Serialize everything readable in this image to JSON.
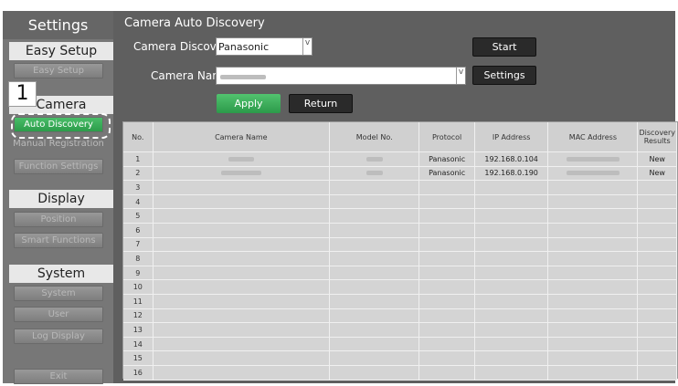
{
  "sidebar": {
    "title": "Settings",
    "sections": [
      {
        "label": "Easy Setup",
        "items": [
          "Easy Setup"
        ]
      },
      {
        "label": "Camera",
        "items": [
          "Auto Discovery",
          "Manual Registration",
          "Function Settings"
        ]
      },
      {
        "label": "Display",
        "items": [
          "Position",
          "Smart Functions"
        ]
      },
      {
        "label": "System",
        "items": [
          "System",
          "User",
          "Log Display"
        ]
      }
    ],
    "exit_label": "Exit",
    "callout_number": "1"
  },
  "main": {
    "title": "Camera Auto Discovery",
    "discovery_label": "Camera Discovery",
    "discovery_value": "Panasonic",
    "camera_name_label": "Camera Name",
    "start_label": "Start",
    "settings_label": "Settings",
    "apply_label": "Apply",
    "return_label": "Return",
    "arrow": "v"
  },
  "table": {
    "headers": [
      "No.",
      "Camera Name",
      "Model No.",
      "Protocol",
      "IP Address",
      "MAC Address",
      "Discovery Results"
    ],
    "rows": [
      {
        "no": "1",
        "protocol": "Panasonic",
        "ip": "192.168.0.104",
        "result": "New"
      },
      {
        "no": "2",
        "protocol": "Panasonic",
        "ip": "192.168.0.190",
        "result": "New"
      },
      {
        "no": "3"
      },
      {
        "no": "4"
      },
      {
        "no": "5"
      },
      {
        "no": "6"
      },
      {
        "no": "7"
      },
      {
        "no": "8"
      },
      {
        "no": "9"
      },
      {
        "no": "10"
      },
      {
        "no": "11"
      },
      {
        "no": "12"
      },
      {
        "no": "13"
      },
      {
        "no": "14"
      },
      {
        "no": "15"
      },
      {
        "no": "16"
      }
    ]
  }
}
